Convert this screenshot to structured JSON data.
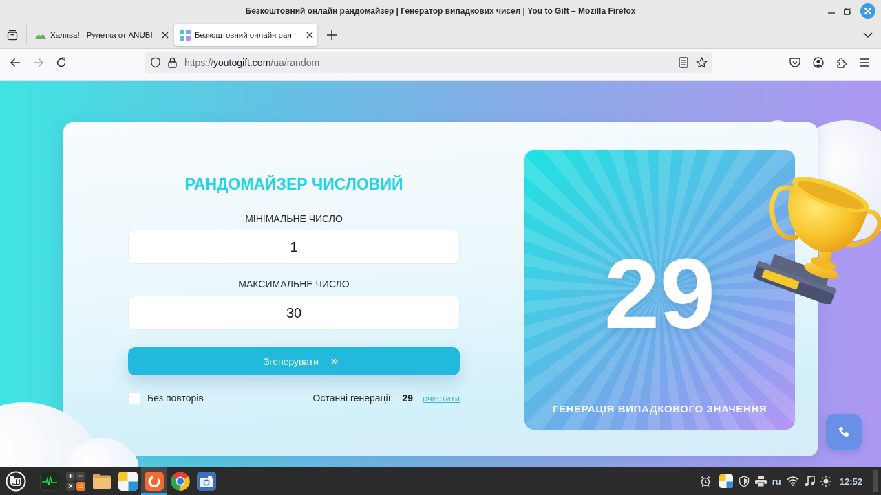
{
  "window": {
    "title": "Безкоштовний онлайн рандомайзер | Генератор випадкових чисел | You to Gift – Mozilla Firefox"
  },
  "tabs": [
    {
      "label": "Халява! - Рулетка от ANUBI",
      "kind": "hills",
      "selected": false
    },
    {
      "label": "Безкоштовний онлайн ран",
      "kind": "tiles",
      "selected": true
    }
  ],
  "navigation": {
    "back_disabled": false,
    "forward_disabled": true
  },
  "address_bar": {
    "url_parts": [
      {
        "text": "https://",
        "kind": "dim"
      },
      {
        "text": "youtogift.com",
        "kind": "host"
      },
      {
        "text": "/ua/random",
        "kind": "dim"
      }
    ]
  },
  "page": {
    "title": "РАНДОМАЙЗЕР ЧИСЛОВИЙ",
    "fields": [
      {
        "label": "МІНІМАЛЬНЕ ЧИСЛО",
        "value": "1"
      },
      {
        "label": "МАКСИМАЛЬНЕ ЧИСЛО",
        "value": "30"
      }
    ],
    "generate_button": "Згенерувати",
    "no_repeats": {
      "label": "Без повторів",
      "checked": false
    },
    "history": {
      "label": "Останні генерації:",
      "values": [
        "29"
      ],
      "clear": "очистити"
    },
    "result": {
      "value": "29",
      "caption": "ГЕНЕРАЦІЯ ВИПАДКОВОГО ЗНАЧЕННЯ"
    }
  },
  "taskbar": {
    "apps": [
      {
        "kind": "monitor",
        "active": false
      },
      {
        "kind": "calculator",
        "active": false
      },
      {
        "kind": "files",
        "active": false
      },
      {
        "kind": "office",
        "active": false
      },
      {
        "kind": "firefox",
        "active": true
      },
      {
        "kind": "chrome",
        "active": false
      },
      {
        "kind": "camera",
        "active": false
      }
    ],
    "tray": {
      "keyboard_layout": "ru",
      "clock": "12:52"
    }
  }
}
